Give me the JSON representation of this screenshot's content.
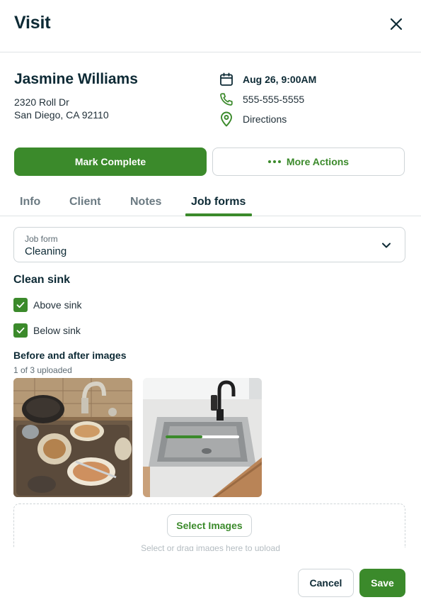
{
  "header": {
    "title": "Visit",
    "close_icon": "close-icon"
  },
  "client": {
    "name": "Jasmine Williams",
    "address_line1": "2320 Roll Dr",
    "address_line2": "San Diego, CA 92110"
  },
  "details": {
    "datetime": "Aug 26, 9:00AM",
    "phone": "555-555-5555",
    "directions": "Directions"
  },
  "actions": {
    "mark_complete": "Mark Complete",
    "more_actions": "More Actions"
  },
  "tabs": [
    {
      "label": "Info",
      "active": false
    },
    {
      "label": "Client",
      "active": false
    },
    {
      "label": "Notes",
      "active": false
    },
    {
      "label": "Job forms",
      "active": true
    }
  ],
  "job_form": {
    "label": "Job form",
    "value": "Cleaning"
  },
  "section": {
    "title": "Clean sink",
    "items": [
      {
        "label": "Above sink",
        "checked": true
      },
      {
        "label": "Below sink",
        "checked": true
      }
    ]
  },
  "images": {
    "title": "Before and after images",
    "count_text": "1 of 3 uploaded",
    "upload_progress": 0.5,
    "select_label": "Select Images",
    "hint": "Select or drag images here to upload"
  },
  "footer": {
    "cancel": "Cancel",
    "save": "Save"
  },
  "colors": {
    "accent": "#3b8a2b",
    "text": "#0d2a35",
    "border": "#cfd5d8"
  }
}
